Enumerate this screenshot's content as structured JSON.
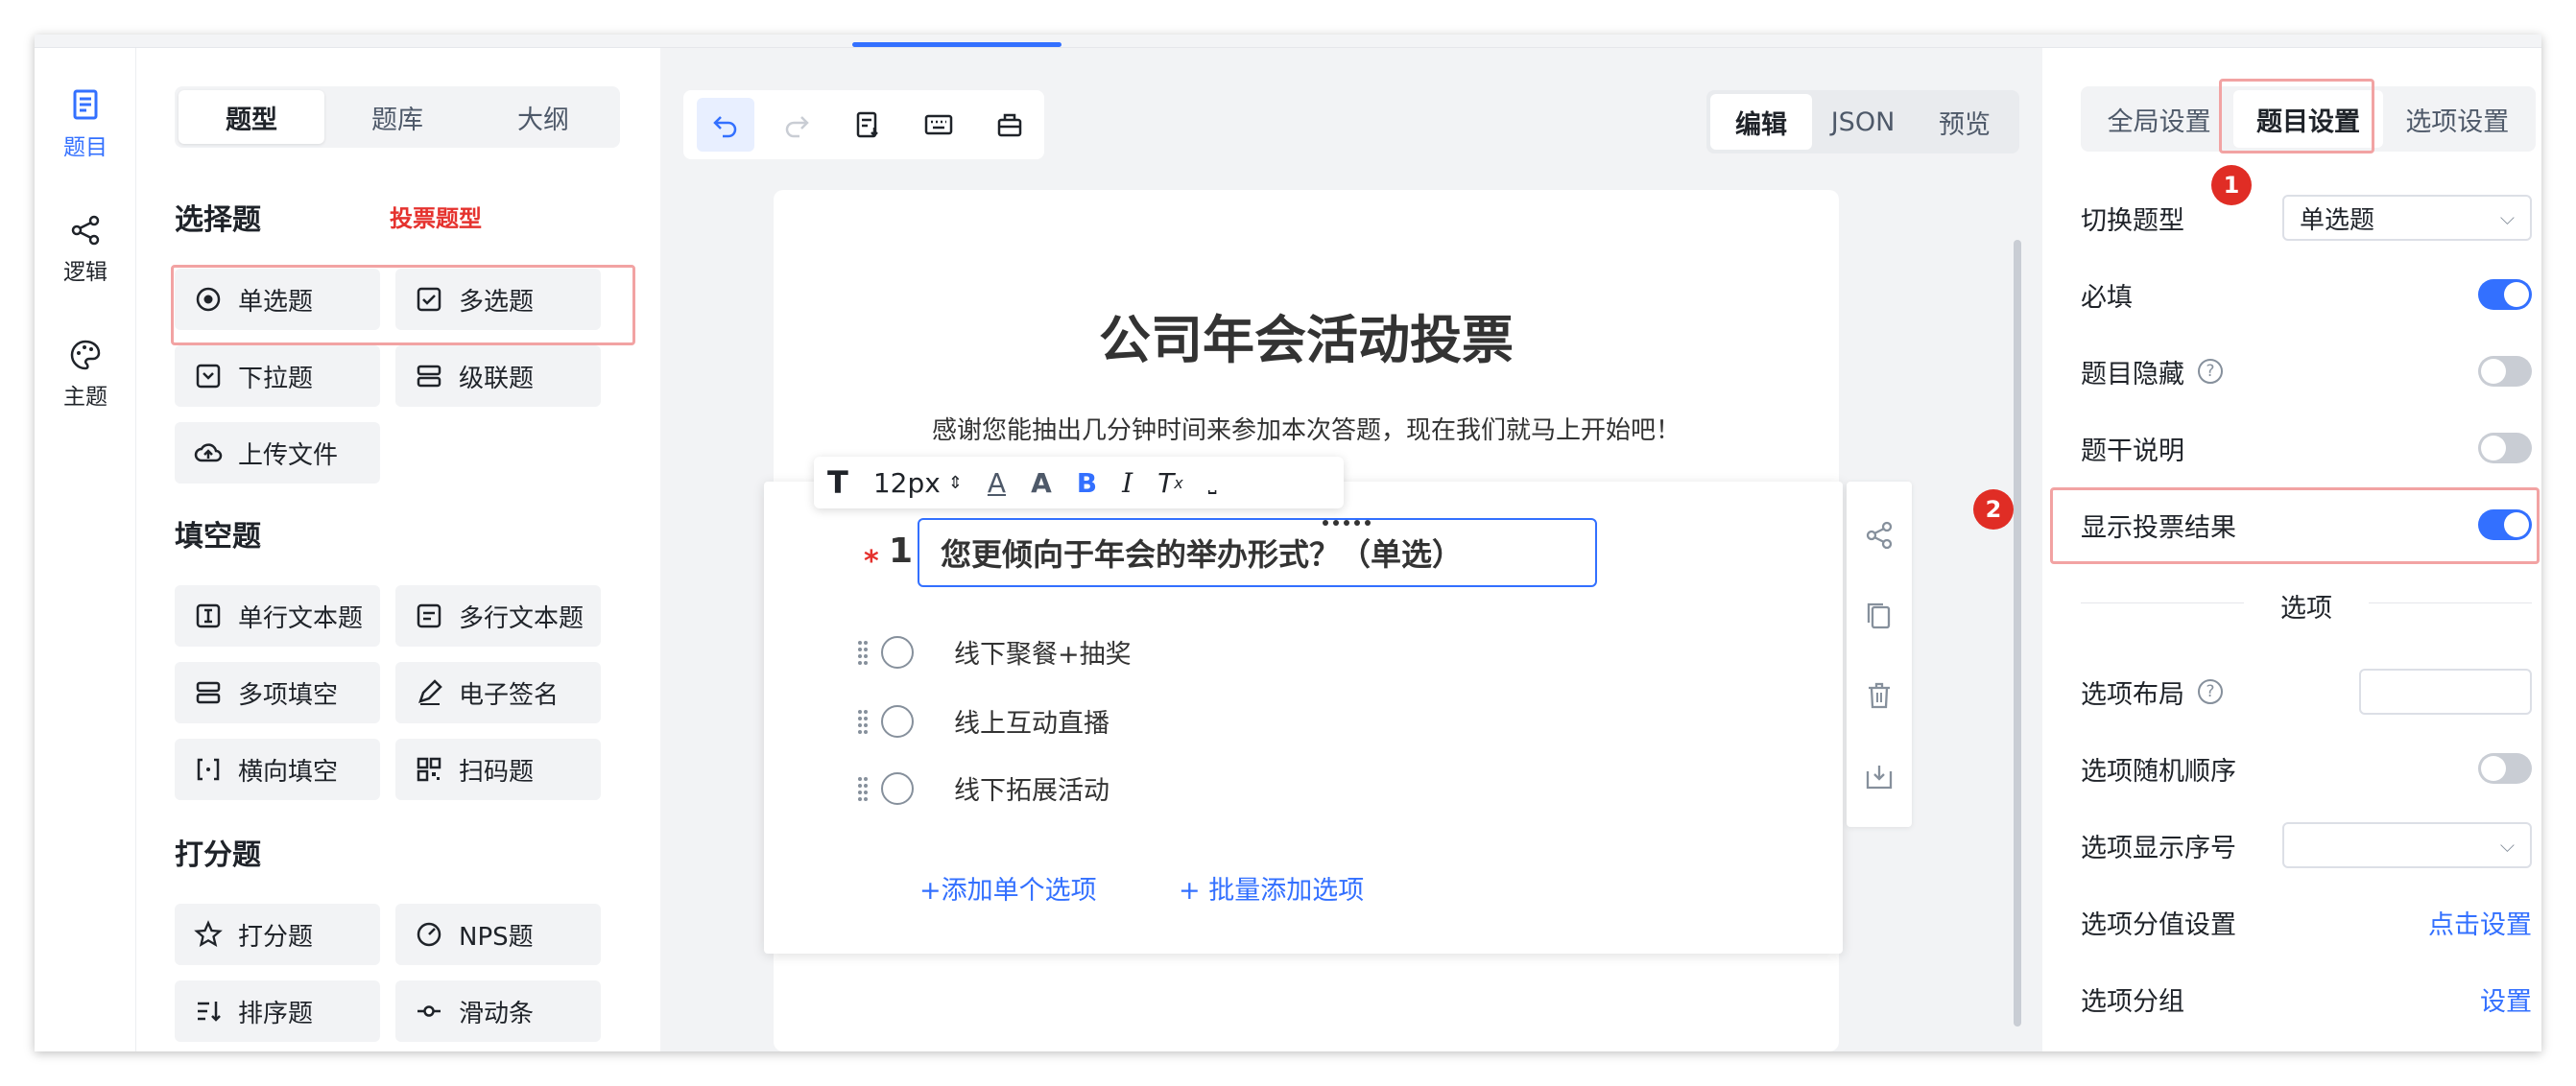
{
  "rail": {
    "items": [
      {
        "label": "题目"
      },
      {
        "label": "逻辑"
      },
      {
        "label": "主题"
      }
    ]
  },
  "components": {
    "tabs": [
      "题型",
      "题库",
      "大纲"
    ],
    "sections": [
      {
        "title": "选择题",
        "items": [
          "单选题",
          "多选题",
          "下拉题",
          "级联题",
          "上传文件"
        ]
      },
      {
        "title": "填空题",
        "items": [
          "单行文本题",
          "多行文本题",
          "多项填空",
          "电子签名",
          "横向填空",
          "扫码题"
        ]
      },
      {
        "title": "打分题",
        "items": [
          "打分题",
          "NPS题",
          "排序题",
          "滑动条"
        ]
      }
    ],
    "note": "投票题型"
  },
  "toolbar": {
    "icons": [
      "undo-icon",
      "redo-icon",
      "import-icon",
      "keyboard-icon",
      "save-icon"
    ]
  },
  "modes": [
    "编辑",
    "JSON",
    "预览"
  ],
  "survey": {
    "title": "公司年会活动投票",
    "description": "感谢您能抽出几分钟时间来参加本次答题，现在我们就马上开始吧！",
    "question": {
      "number": "1",
      "required_mark": "*",
      "title": "您更倾向于年会的举办形式？（单选）",
      "options": [
        "线下聚餐+抽奖",
        "线上互动直播",
        "线下拓展活动"
      ],
      "add_single": "+添加单个选项",
      "add_batch": "+ 批量添加选项"
    },
    "rich_toolbar": {
      "font_size": "12px"
    }
  },
  "settings": {
    "tabs": [
      "全局设置",
      "题目设置",
      "选项设置"
    ],
    "switch_type_label": "切换题型",
    "switch_type_value": "单选题",
    "required_label": "必填",
    "required_on": true,
    "hidden_label": "题目隐藏",
    "hidden_on": false,
    "desc_label": "题干说明",
    "desc_on": false,
    "vote_label": "显示投票结果",
    "vote_on": true,
    "options_divider": "选项",
    "layout_label": "选项布局",
    "random_label": "选项随机顺序",
    "random_on": false,
    "seq_label": "选项显示序号",
    "score_label": "选项分值设置",
    "score_link": "点击设置",
    "group_label": "选项分组",
    "group_link": "设置"
  },
  "badges": [
    "1",
    "2"
  ],
  "colors": {
    "accent": "#3370ff",
    "annotation": "#e02d25"
  }
}
